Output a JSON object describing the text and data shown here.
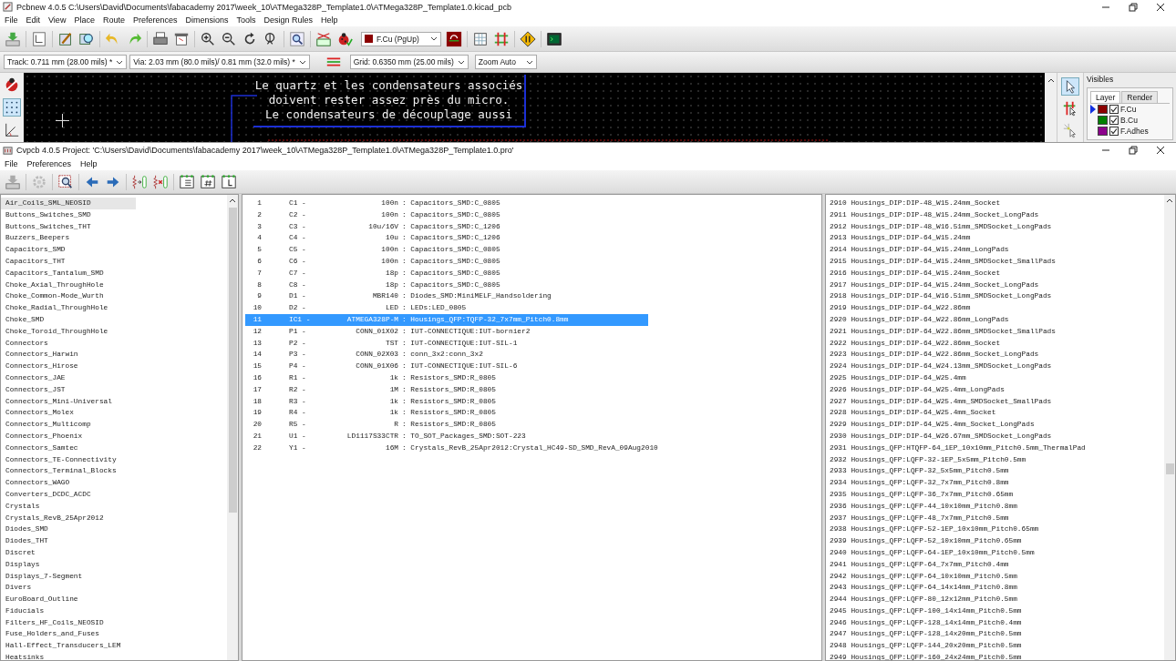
{
  "pcbnew": {
    "title": "Pcbnew 4.0.5 C:\\Users\\David\\Documents\\fabacademy 2017\\week_10\\ATMega328P_Template1.0\\ATMega328P_Template1.0.kicad_pcb",
    "menu": [
      "File",
      "Edit",
      "View",
      "Place",
      "Route",
      "Preferences",
      "Dimensions",
      "Tools",
      "Design Rules",
      "Help"
    ],
    "layer_select": "F.Cu (PgUp)",
    "track": "Track: 0.711 mm (28.00 mils) *",
    "via": "Via: 2.03 mm (80.0 mils)/ 0.81 mm (32.0 mils) *",
    "grid": "Grid: 0.6350 mm (25.00 mils)",
    "zoom": "Zoom Auto",
    "canvas_text": [
      "Le quartz et les condensateurs associés",
      "doivent rester assez près du micro.",
      "Le condensateurs de découplage aussi"
    ],
    "visibles": {
      "title": "Visibles",
      "tabs": [
        {
          "label": "Layer",
          "selected": true
        },
        {
          "label": "Render",
          "selected": false
        }
      ],
      "layers": [
        {
          "name": "F.Cu",
          "color": "#8b0000",
          "checked": true,
          "selected": true
        },
        {
          "name": "B.Cu",
          "color": "#008000",
          "checked": true,
          "selected": false
        },
        {
          "name": "F.Adhes",
          "color": "#8b008b",
          "checked": true,
          "selected": false
        }
      ]
    }
  },
  "cvpcb": {
    "title": "Cvpcb 4.0.5  Project: 'C:\\Users\\David\\Documents\\fabacademy 2017\\week_10\\ATMega328P_Template1.0\\ATMega328P_Template1.0.pro'",
    "menu": [
      "File",
      "Preferences",
      "Help"
    ],
    "libraries": [
      {
        "name": "Air_Coils_SML_NEOSID",
        "selected": true
      },
      {
        "name": "Buttons_Switches_SMD",
        "selected": false
      },
      {
        "name": "Buttons_Switches_THT",
        "selected": false
      },
      {
        "name": "Buzzers_Beepers",
        "selected": false
      },
      {
        "name": "Capacitors_SMD",
        "selected": false
      },
      {
        "name": "Capacitors_THT",
        "selected": false
      },
      {
        "name": "Capacitors_Tantalum_SMD",
        "selected": false
      },
      {
        "name": "Choke_Axial_ThroughHole",
        "selected": false
      },
      {
        "name": "Choke_Common-Mode_Wurth",
        "selected": false
      },
      {
        "name": "Choke_Radial_ThroughHole",
        "selected": false
      },
      {
        "name": "Choke_SMD",
        "selected": false
      },
      {
        "name": "Choke_Toroid_ThroughHole",
        "selected": false
      },
      {
        "name": "Connectors",
        "selected": false
      },
      {
        "name": "Connectors_Harwin",
        "selected": false
      },
      {
        "name": "Connectors_Hirose",
        "selected": false
      },
      {
        "name": "Connectors_JAE",
        "selected": false
      },
      {
        "name": "Connectors_JST",
        "selected": false
      },
      {
        "name": "Connectors_Mini-Universal",
        "selected": false
      },
      {
        "name": "Connectors_Molex",
        "selected": false
      },
      {
        "name": "Connectors_Multicomp",
        "selected": false
      },
      {
        "name": "Connectors_Phoenix",
        "selected": false
      },
      {
        "name": "Connectors_Samtec",
        "selected": false
      },
      {
        "name": "Connectors_TE-Connectivity",
        "selected": false
      },
      {
        "name": "Connectors_Terminal_Blocks",
        "selected": false
      },
      {
        "name": "Connectors_WAGO",
        "selected": false
      },
      {
        "name": "Converters_DCDC_ACDC",
        "selected": false
      },
      {
        "name": "Crystals",
        "selected": false
      },
      {
        "name": "Crystals_RevB_25Apr2012",
        "selected": false
      },
      {
        "name": "Diodes_SMD",
        "selected": false
      },
      {
        "name": "Diodes_THT",
        "selected": false
      },
      {
        "name": "Discret",
        "selected": false
      },
      {
        "name": "Displays",
        "selected": false
      },
      {
        "name": "Displays_7-Segment",
        "selected": false
      },
      {
        "name": "Divers",
        "selected": false
      },
      {
        "name": "EuroBoard_Outline",
        "selected": false
      },
      {
        "name": "Fiducials",
        "selected": false
      },
      {
        "name": "Filters_HF_Coils_NEOSID",
        "selected": false
      },
      {
        "name": "Fuse_Holders_and_Fuses",
        "selected": false
      },
      {
        "name": "Hall-Effect_Transducers_LEM",
        "selected": false
      },
      {
        "name": "Heatsinks",
        "selected": false
      }
    ],
    "components": [
      {
        "index": "1",
        "ref": "C1 -",
        "value": "100n",
        "footprint": ": Capacitors_SMD:C_0805",
        "selected": false
      },
      {
        "index": "2",
        "ref": "C2 -",
        "value": "100n",
        "footprint": ": Capacitors_SMD:C_0805",
        "selected": false
      },
      {
        "index": "3",
        "ref": "C3 -",
        "value": "10u/16V",
        "footprint": ": Capacitors_SMD:C_1206",
        "selected": false
      },
      {
        "index": "4",
        "ref": "C4 -",
        "value": "10u",
        "footprint": ": Capacitors_SMD:C_1206",
        "selected": false
      },
      {
        "index": "5",
        "ref": "C5 -",
        "value": "100n",
        "footprint": ": Capacitors_SMD:C_0805",
        "selected": false
      },
      {
        "index": "6",
        "ref": "C6 -",
        "value": "100n",
        "footprint": ": Capacitors_SMD:C_0805",
        "selected": false
      },
      {
        "index": "7",
        "ref": "C7 -",
        "value": "18p",
        "footprint": ": Capacitors_SMD:C_0805",
        "selected": false
      },
      {
        "index": "8",
        "ref": "C8 -",
        "value": "18p",
        "footprint": ": Capacitors_SMD:C_0805",
        "selected": false
      },
      {
        "index": "9",
        "ref": "D1 -",
        "value": "MBR140",
        "footprint": ": Diodes_SMD:MiniMELF_Handsoldering",
        "selected": false
      },
      {
        "index": "10",
        "ref": "D2 -",
        "value": "LED",
        "footprint": ": LEDs:LED_0805",
        "selected": false
      },
      {
        "index": "11",
        "ref": "IC1 -",
        "value": "ATMEGA328P-M",
        "footprint": ": Housings_QFP:TQFP-32_7x7mm_Pitch0.8mm",
        "selected": true
      },
      {
        "index": "12",
        "ref": "P1 -",
        "value": "CONN_01X02",
        "footprint": ": IUT-CONNECTIQUE:IUT-bornier2",
        "selected": false
      },
      {
        "index": "13",
        "ref": "P2 -",
        "value": "TST",
        "footprint": ": IUT-CONNECTIQUE:IUT-SIL-1",
        "selected": false
      },
      {
        "index": "14",
        "ref": "P3 -",
        "value": "CONN_02X03",
        "footprint": ": conn_3x2:conn_3x2",
        "selected": false
      },
      {
        "index": "15",
        "ref": "P4 -",
        "value": "CONN_01X06",
        "footprint": ": IUT-CONNECTIQUE:IUT-SIL-6",
        "selected": false
      },
      {
        "index": "16",
        "ref": "R1 -",
        "value": "1k",
        "footprint": ": Resistors_SMD:R_0805",
        "selected": false
      },
      {
        "index": "17",
        "ref": "R2 -",
        "value": "1M",
        "footprint": ": Resistors_SMD:R_0805",
        "selected": false
      },
      {
        "index": "18",
        "ref": "R3 -",
        "value": "1k",
        "footprint": ": Resistors_SMD:R_0805",
        "selected": false
      },
      {
        "index": "19",
        "ref": "R4 -",
        "value": "1k",
        "footprint": ": Resistors_SMD:R_0805",
        "selected": false
      },
      {
        "index": "20",
        "ref": "R5 -",
        "value": "R",
        "footprint": ": Resistors_SMD:R_0805",
        "selected": false
      },
      {
        "index": "21",
        "ref": "U1 -",
        "value": "LD1117S33CTR",
        "footprint": ": TO_SOT_Packages_SMD:SOT-223",
        "selected": false
      },
      {
        "index": "22",
        "ref": "Y1 -",
        "value": "16M",
        "footprint": ": Crystals_RevB_25Apr2012:Crystal_HC49-SD_SMD_RevA_09Aug2010",
        "selected": false
      }
    ],
    "footprints": [
      "2910 Housings_DIP:DIP-48_W15.24mm_Socket",
      "2911 Housings_DIP:DIP-48_W15.24mm_Socket_LongPads",
      "2912 Housings_DIP:DIP-48_W16.51mm_SMDSocket_LongPads",
      "2913 Housings_DIP:DIP-64_W15.24mm",
      "2914 Housings_DIP:DIP-64_W15.24mm_LongPads",
      "2915 Housings_DIP:DIP-64_W15.24mm_SMDSocket_SmallPads",
      "2916 Housings_DIP:DIP-64_W15.24mm_Socket",
      "2917 Housings_DIP:DIP-64_W15.24mm_Socket_LongPads",
      "2918 Housings_DIP:DIP-64_W16.51mm_SMDSocket_LongPads",
      "2919 Housings_DIP:DIP-64_W22.86mm",
      "2920 Housings_DIP:DIP-64_W22.86mm_LongPads",
      "2921 Housings_DIP:DIP-64_W22.86mm_SMDSocket_SmallPads",
      "2922 Housings_DIP:DIP-64_W22.86mm_Socket",
      "2923 Housings_DIP:DIP-64_W22.86mm_Socket_LongPads",
      "2924 Housings_DIP:DIP-64_W24.13mm_SMDSocket_LongPads",
      "2925 Housings_DIP:DIP-64_W25.4mm",
      "2926 Housings_DIP:DIP-64_W25.4mm_LongPads",
      "2927 Housings_DIP:DIP-64_W25.4mm_SMDSocket_SmallPads",
      "2928 Housings_DIP:DIP-64_W25.4mm_Socket",
      "2929 Housings_DIP:DIP-64_W25.4mm_Socket_LongPads",
      "2930 Housings_DIP:DIP-64_W26.67mm_SMDSocket_LongPads",
      "2931 Housings_QFP:HTQFP-64_1EP_10x10mm_Pitch0.5mm_ThermalPad",
      "2932 Housings_QFP:LQFP-32-1EP_5x5mm_Pitch0.5mm",
      "2933 Housings_QFP:LQFP-32_5x5mm_Pitch0.5mm",
      "2934 Housings_QFP:LQFP-32_7x7mm_Pitch0.8mm",
      "2935 Housings_QFP:LQFP-36_7x7mm_Pitch0.65mm",
      "2936 Housings_QFP:LQFP-44_10x10mm_Pitch0.8mm",
      "2937 Housings_QFP:LQFP-48_7x7mm_Pitch0.5mm",
      "2938 Housings_QFP:LQFP-52-1EP_10x10mm_Pitch0.65mm",
      "2939 Housings_QFP:LQFP-52_10x10mm_Pitch0.65mm",
      "2940 Housings_QFP:LQFP-64-1EP_10x10mm_Pitch0.5mm",
      "2941 Housings_QFP:LQFP-64_7x7mm_Pitch0.4mm",
      "2942 Housings_QFP:LQFP-64_10x10mm_Pitch0.5mm",
      "2943 Housings_QFP:LQFP-64_14x14mm_Pitch0.8mm",
      "2944 Housings_QFP:LQFP-80_12x12mm_Pitch0.5mm",
      "2945 Housings_QFP:LQFP-100_14x14mm_Pitch0.5mm",
      "2946 Housings_QFP:LQFP-128_14x14mm_Pitch0.4mm",
      "2947 Housings_QFP:LQFP-128_14x20mm_Pitch0.5mm",
      "2948 Housings_QFP:LQFP-144_20x20mm_Pitch0.5mm",
      "2949 Housings_QFP:LQFP-160_24x24mm_Pitch0.5mm"
    ]
  }
}
